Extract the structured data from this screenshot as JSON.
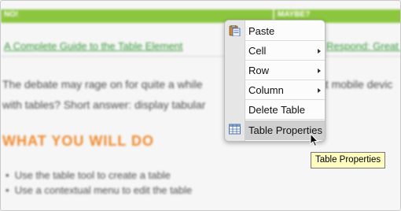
{
  "background": {
    "header_left": "NO!",
    "header_right": "MAYBE?",
    "link_left": "A Complete Guide to the Table Element",
    "link_right": "Respond: Great R",
    "para_line1": "The debate may rage on for quite a while",
    "para_line1_right": "at mobile devic",
    "para_line2": "with tables? Short answer: display tabular",
    "heading": "WHAT YOU WILL DO",
    "bullets": [
      "Use the table tool to create a table",
      "Use a contextual menu to edit the table"
    ],
    "colors": {
      "header_green": "#8cc63f",
      "link_green": "#3b9a3b",
      "heading_orange": "#ef8a2e"
    }
  },
  "context_menu": {
    "items": [
      {
        "label": "Paste",
        "icon": "clipboard-icon",
        "submenu": false
      },
      {
        "label": "Cell",
        "submenu": true
      },
      {
        "label": "Row",
        "submenu": true
      },
      {
        "label": "Column",
        "submenu": true
      },
      {
        "label": "Delete Table",
        "submenu": false
      },
      {
        "label": "Table Properties",
        "icon": "table-icon",
        "submenu": false,
        "highlighted": true
      }
    ]
  },
  "tooltip": {
    "text": "Table Properties"
  },
  "cursor": {
    "icon": "pointer-arrow-icon"
  }
}
